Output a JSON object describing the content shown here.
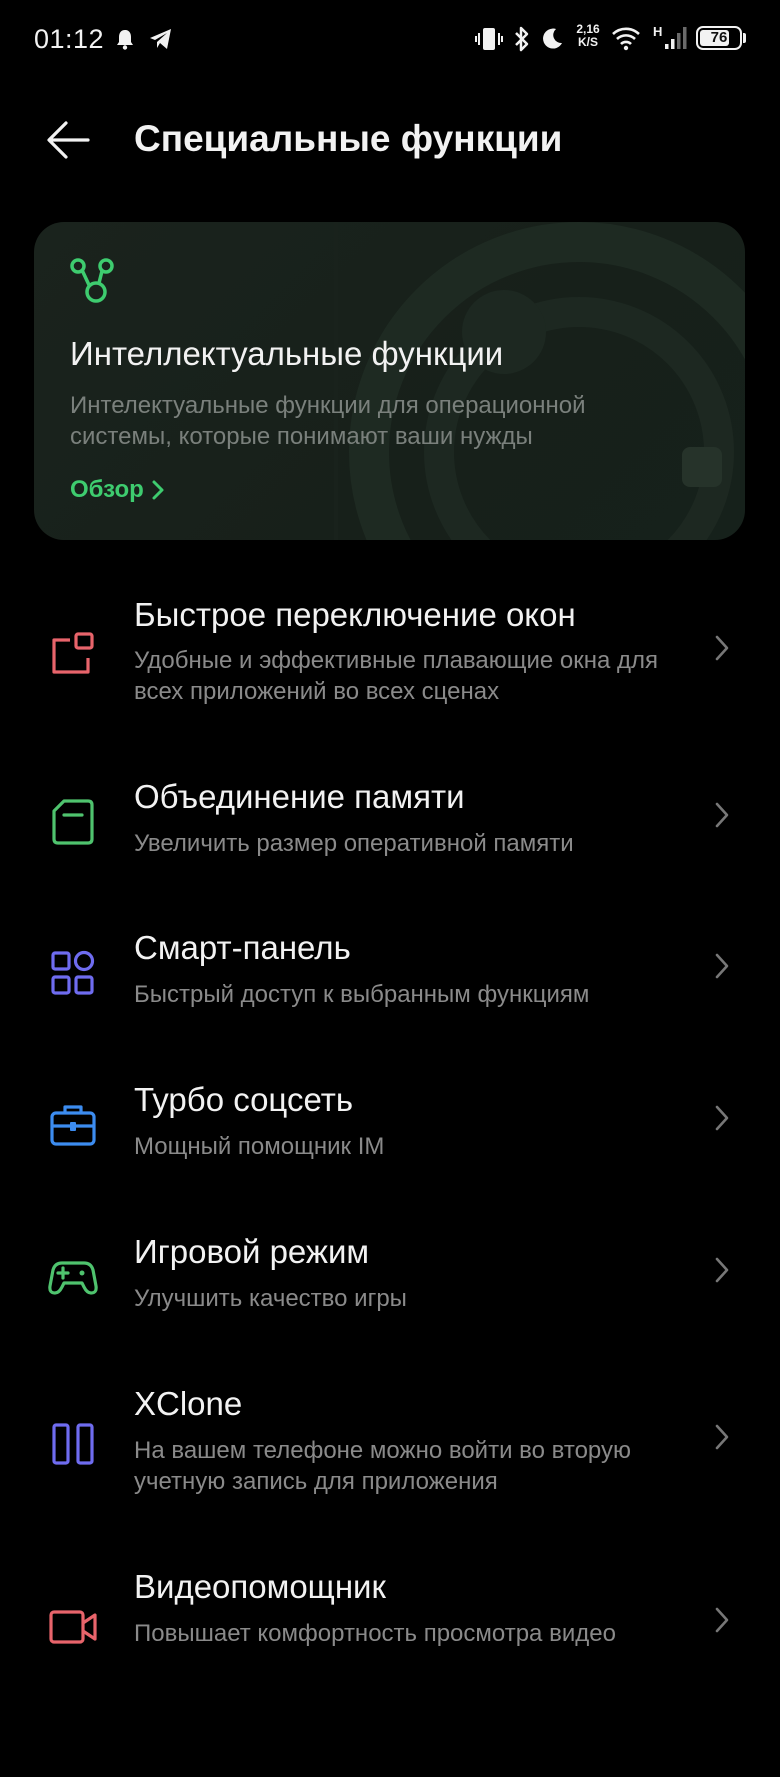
{
  "status_bar": {
    "time": "01:12",
    "net_speed_value": "2,16",
    "net_speed_unit": "K/S",
    "network_type": "H",
    "battery_level": "76",
    "battery_fraction": 0.76
  },
  "header": {
    "title": "Специальные функции"
  },
  "promo": {
    "title": "Интеллектуальные функции",
    "description": "Интелектуальные функции для операционной системы, которые понимают ваши нужды",
    "link_label": "Обзор",
    "accent_color": "#3ecc6f"
  },
  "items": [
    {
      "icon": "floating-window-icon",
      "color": "#e8646b",
      "title": "Быстрое переключение окон",
      "subtitle": "Удобные и эффективные плавающие окна для всех приложений во всех сценах"
    },
    {
      "icon": "memory-card-icon",
      "color": "#4fc36e",
      "title": "Объединение памяти",
      "subtitle": "Увеличить размер оперативной памяти"
    },
    {
      "icon": "grid-panel-icon",
      "color": "#6f6cf0",
      "title": "Смарт-панель",
      "subtitle": "Быстрый доступ к выбранным функциям"
    },
    {
      "icon": "toolbox-icon",
      "color": "#3c8cf0",
      "title": "Турбо соцсеть",
      "subtitle": "Мощный помощник IM"
    },
    {
      "icon": "gamepad-icon",
      "color": "#4fc36e",
      "title": "Игровой режим",
      "subtitle": "Улучшить качество игры"
    },
    {
      "icon": "dual-app-icon",
      "color": "#6f6cf0",
      "title": "XClone",
      "subtitle": "На вашем телефоне можно войти во вторую учетную запись для приложения"
    },
    {
      "icon": "video-camera-icon",
      "color": "#e8646b",
      "title": "Видеопомощник",
      "subtitle": "Повышает комфортность просмотра видео"
    }
  ]
}
